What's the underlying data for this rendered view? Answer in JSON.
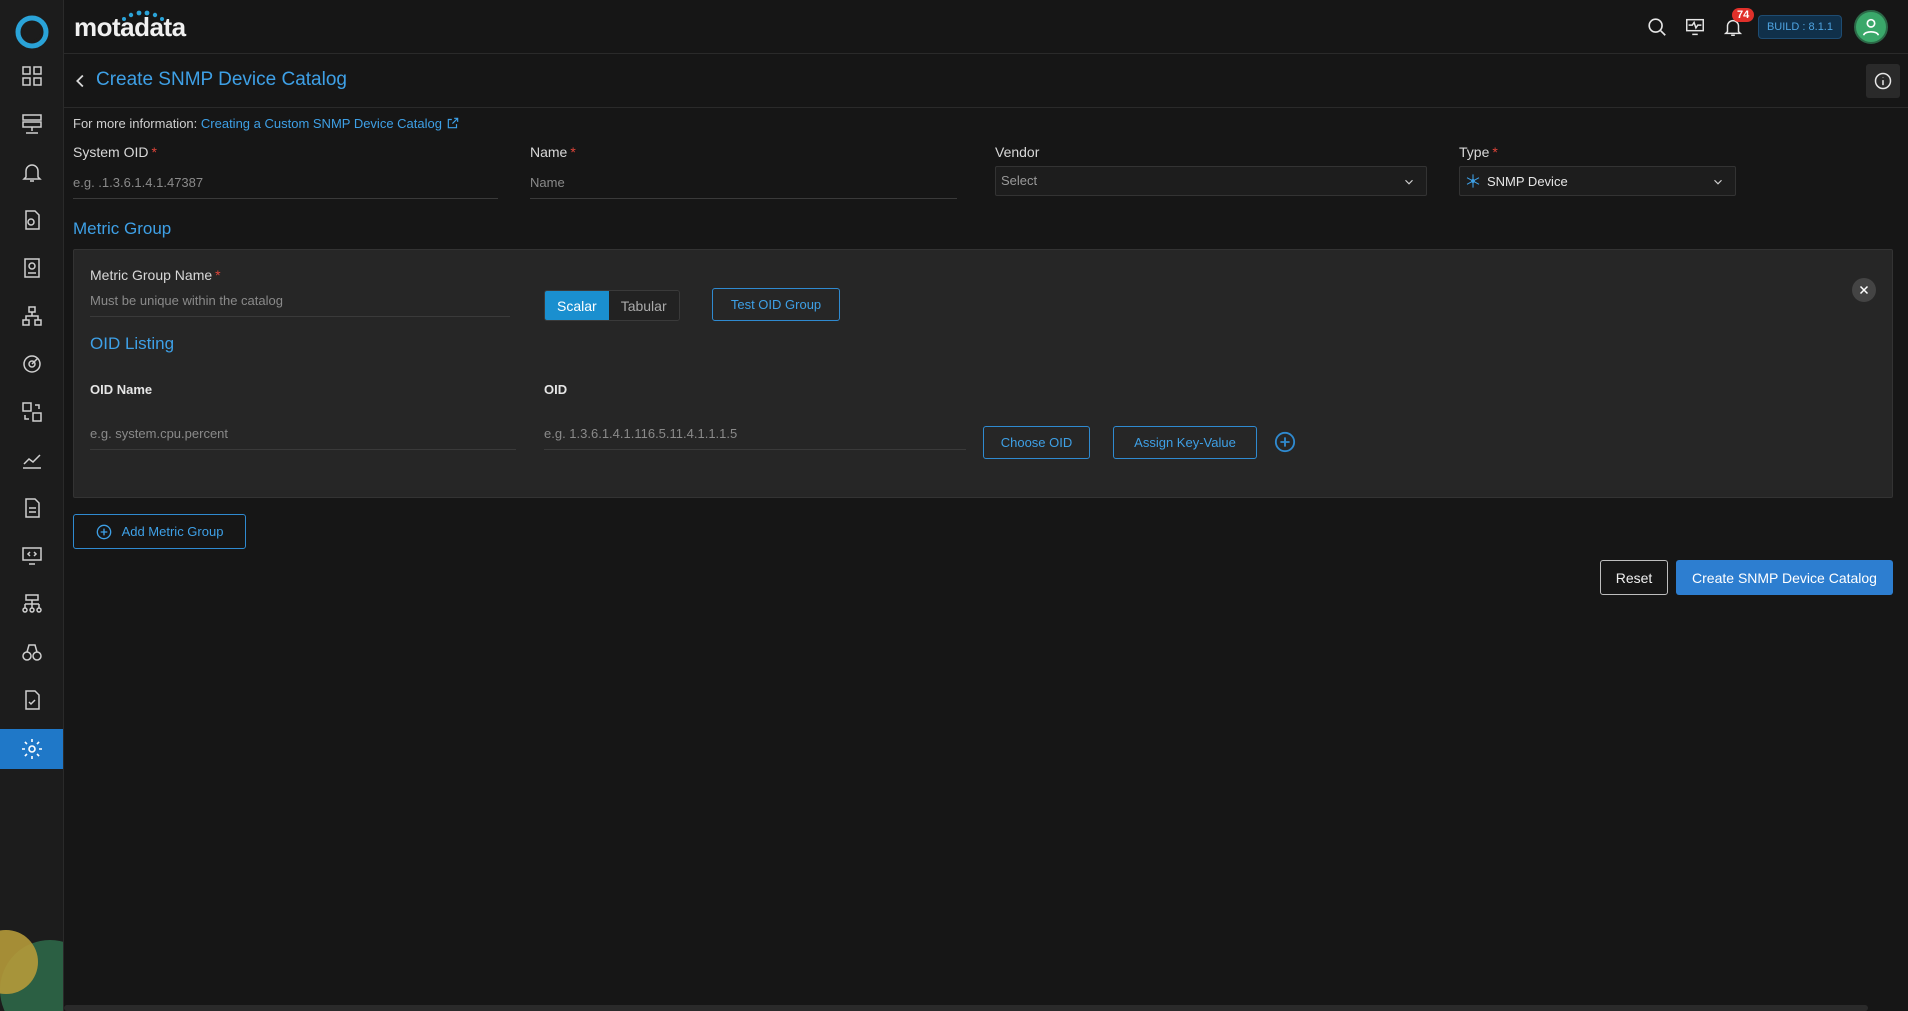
{
  "header": {
    "brand": "motadata",
    "notification_count": "74",
    "build": "BUILD : 8.1.1"
  },
  "page": {
    "title": "Create SNMP Device Catalog",
    "more_info_prefix": "For more information:",
    "more_info_link": "Creating a Custom SNMP Device Catalog"
  },
  "form": {
    "system_oid": {
      "label": "System OID",
      "required": "*",
      "placeholder": "e.g. .1.3.6.1.4.1.47387"
    },
    "name": {
      "label": "Name",
      "required": "*",
      "placeholder": "Name"
    },
    "vendor": {
      "label": "Vendor",
      "value": "Select"
    },
    "type": {
      "label": "Type",
      "required": "*",
      "value": "SNMP Device"
    }
  },
  "metric_group": {
    "section_title": "Metric Group",
    "name_label": "Metric Group Name",
    "name_required": "*",
    "name_placeholder": "Must be unique within the catalog",
    "mode_options": [
      "Scalar",
      "Tabular"
    ],
    "mode_selected": "Scalar",
    "test_button": "Test OID Group",
    "oid_listing_title": "OID Listing",
    "oid_name_header": "OID Name",
    "oid_header": "OID",
    "oid_name_placeholder": "e.g. system.cpu.percent",
    "oid_placeholder": "e.g. 1.3.6.1.4.1.116.5.11.4.1.1.1.5",
    "choose_oid_button": "Choose OID",
    "assign_kv_button": "Assign Key-Value"
  },
  "actions": {
    "add_metric_group": "Add Metric Group",
    "reset": "Reset",
    "create": "Create SNMP Device Catalog"
  },
  "colors": {
    "accent": "#3ea0e6",
    "primary_button": "#2d7ed0",
    "active_sidebar": "#1f78c8",
    "badge": "#e0302a"
  }
}
